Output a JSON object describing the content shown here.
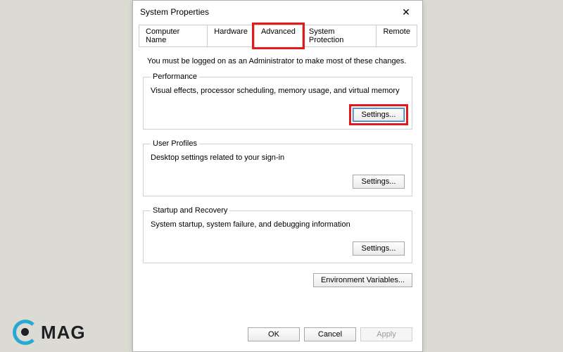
{
  "window_title": "System Properties",
  "tabs": {
    "computer_name": "Computer Name",
    "hardware": "Hardware",
    "advanced": "Advanced",
    "system_protection": "System Protection",
    "remote": "Remote"
  },
  "admin_note": "You must be logged on as an Administrator to make most of these changes.",
  "groups": {
    "performance": {
      "legend": "Performance",
      "desc": "Visual effects, processor scheduling, memory usage, and virtual memory",
      "button": "Settings..."
    },
    "user_profiles": {
      "legend": "User Profiles",
      "desc": "Desktop settings related to your sign-in",
      "button": "Settings..."
    },
    "startup": {
      "legend": "Startup and Recovery",
      "desc": "System startup, system failure, and debugging information",
      "button": "Settings..."
    }
  },
  "env_button": "Environment Variables...",
  "buttons": {
    "ok": "OK",
    "cancel": "Cancel",
    "apply": "Apply"
  },
  "logo_text": "MAG"
}
